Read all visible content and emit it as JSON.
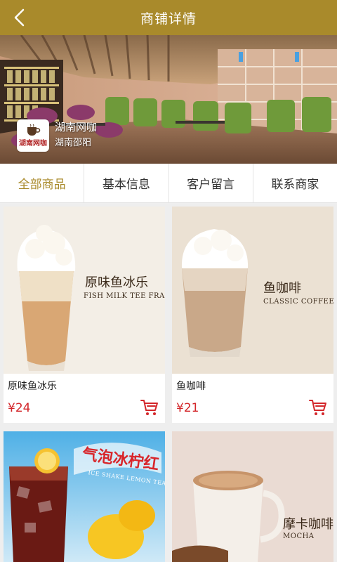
{
  "header": {
    "title": "商铺详情",
    "back_icon": "chevron-left-icon"
  },
  "shop": {
    "name": "湖南网咖",
    "location": "湖南邵阳",
    "logo_text": "湖南网咖"
  },
  "tabs": [
    {
      "label": "全部商品",
      "active": true
    },
    {
      "label": "基本信息",
      "active": false
    },
    {
      "label": "客户留言",
      "active": false
    },
    {
      "label": "联系商家",
      "active": false
    }
  ],
  "products": [
    {
      "name": "原味鱼冰乐",
      "price": "¥24",
      "overlay_cn": "原味鱼冰乐",
      "overlay_en": "FISH MILK TEE FRAPPE"
    },
    {
      "name": "鱼咖啡",
      "price": "¥21",
      "overlay_cn": "鱼咖啡",
      "overlay_en": "CLASSIC COFFEE"
    },
    {
      "name": "",
      "price": "",
      "overlay_cn": "气泡冰柠红",
      "overlay_en": "ICE SHAKE LEMON TEA"
    },
    {
      "name": "",
      "price": "",
      "overlay_cn": "摩卡咖啡",
      "overlay_en": "MOCHA"
    }
  ],
  "colors": {
    "header_bg": "#a98a2b",
    "accent": "#a98a2b",
    "price": "#d3262a",
    "background": "#eeeeee"
  },
  "icons": {
    "cart": "shopping-cart-icon"
  }
}
